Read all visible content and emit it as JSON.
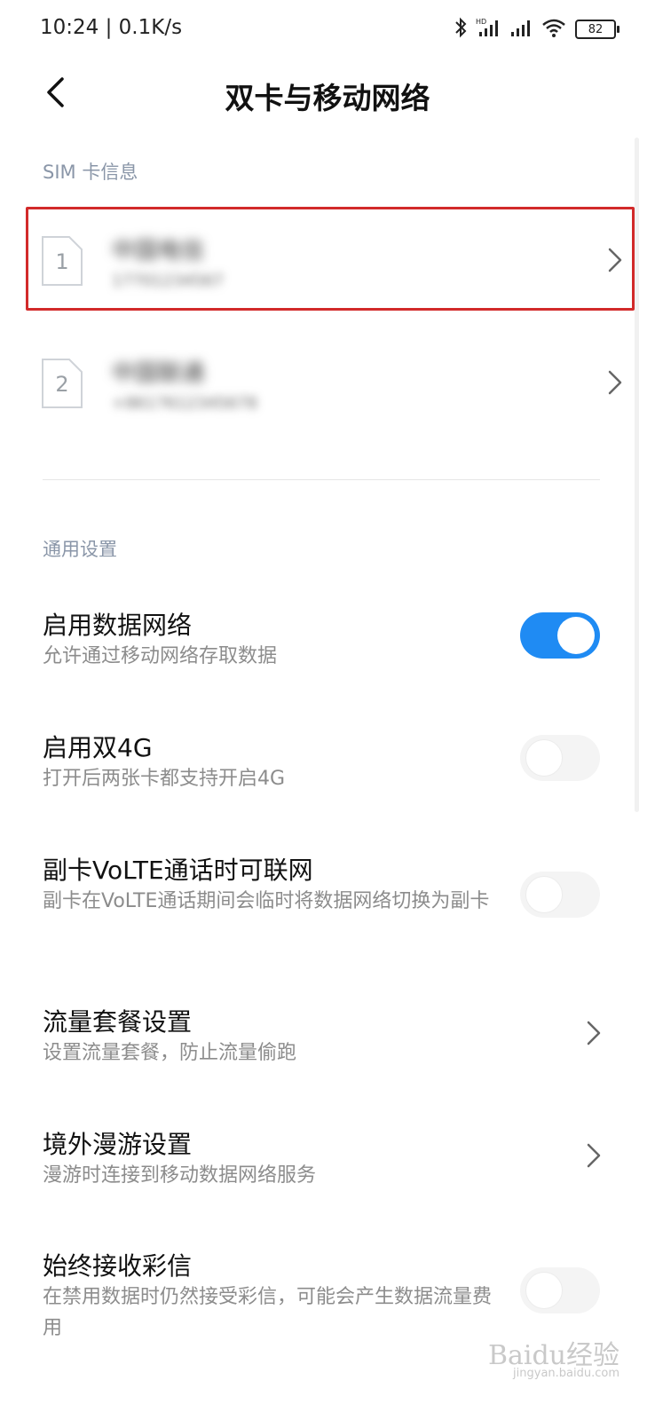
{
  "status_bar": {
    "time": "10:24 | 0.1K/s",
    "battery": "82",
    "icons": [
      "bluetooth-icon",
      "hd-signal-icon",
      "signal-icon",
      "wifi-icon",
      "battery-icon"
    ]
  },
  "header": {
    "title": "双卡与移动网络"
  },
  "sim_section": {
    "title": "SIM 卡信息",
    "cards": [
      {
        "slot": "1",
        "carrier": "中国电信",
        "number": "17701234567"
      },
      {
        "slot": "2",
        "carrier": "中国联通",
        "number": "+8617612345678"
      }
    ]
  },
  "general_section": {
    "title": "通用设置",
    "items": [
      {
        "title": "启用数据网络",
        "subtitle": "允许通过移动网络存取数据",
        "control": "toggle",
        "on": true
      },
      {
        "title": "启用双4G",
        "subtitle": "打开后两张卡都支持开启4G",
        "control": "toggle",
        "on": false
      },
      {
        "title": "副卡VoLTE通话时可联网",
        "subtitle": "副卡在VoLTE通话期间会临时将数据网络切换为副卡",
        "control": "toggle",
        "on": false
      },
      {
        "title": "流量套餐设置",
        "subtitle": "设置流量套餐，防止流量偷跑",
        "control": "chevron"
      },
      {
        "title": "境外漫游设置",
        "subtitle": "漫游时连接到移动数据网络服务",
        "control": "chevron"
      },
      {
        "title": "始终接收彩信",
        "subtitle": "在禁用数据时仍然接受彩信，可能会产生数据流量费用",
        "control": "toggle",
        "on": false
      }
    ]
  },
  "watermark": {
    "text": "Baidu经验",
    "sub": "jingyan.baidu.com"
  },
  "colors": {
    "accent": "#1f8bf3",
    "highlight": "#d22a2a",
    "section_title": "#8a96a8"
  }
}
